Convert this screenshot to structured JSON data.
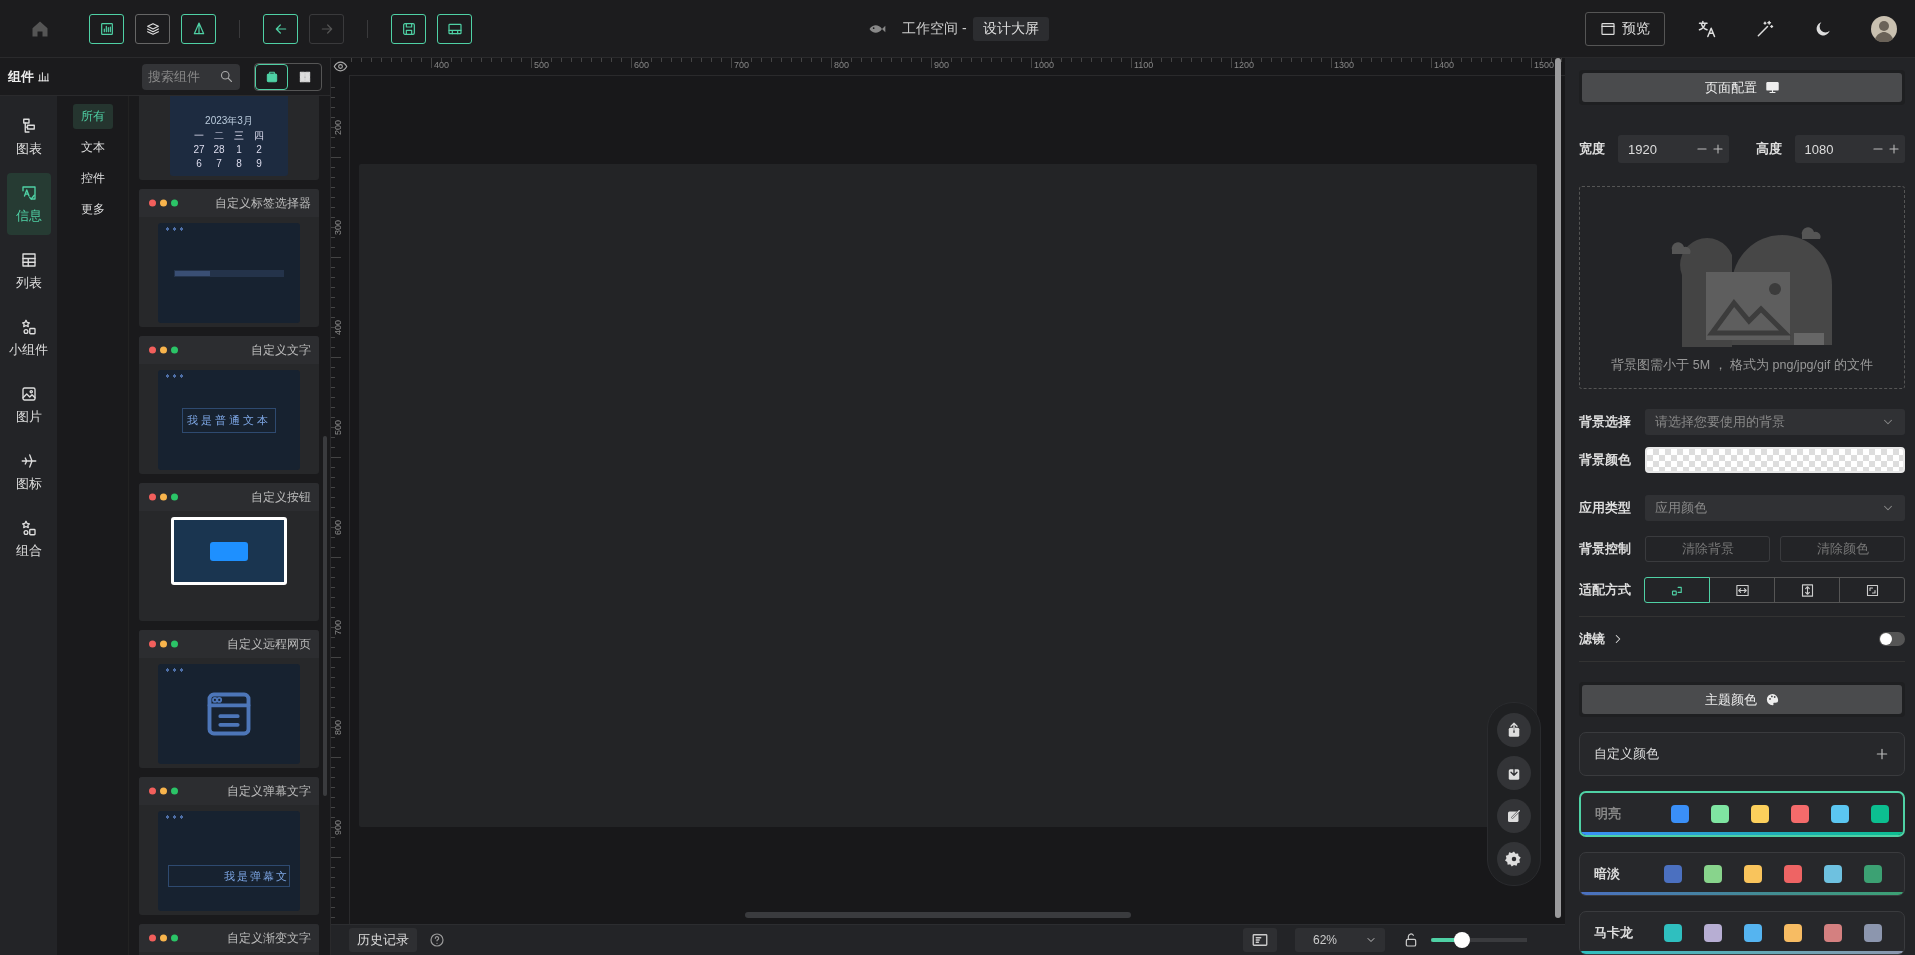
{
  "topbar": {
    "toggles": [
      {
        "kind": "chart",
        "on": true
      },
      {
        "kind": "layers",
        "on": false
      },
      {
        "kind": "cone",
        "on": true
      }
    ],
    "history": [
      {
        "kind": "undo",
        "disabled": false
      },
      {
        "kind": "redo",
        "disabled": true
      }
    ],
    "files": [
      {
        "kind": "save"
      },
      {
        "kind": "layout"
      }
    ],
    "workspace": "工作空间 -",
    "project": "设计大屏",
    "preview": "预览"
  },
  "components": {
    "title": "组件",
    "search": {
      "placeholder": "搜索组件"
    },
    "views": [
      {
        "kind": "card",
        "selected": true
      },
      {
        "kind": "grid",
        "selected": false
      }
    ],
    "groups": [
      {
        "label": "图表",
        "kind": "flow",
        "selected": false
      },
      {
        "label": "信息",
        "kind": "info",
        "selected": true
      },
      {
        "label": "列表",
        "kind": "table",
        "selected": false
      },
      {
        "label": "小组件",
        "kind": "widget",
        "selected": false
      },
      {
        "label": "图片",
        "kind": "image",
        "selected": false
      },
      {
        "label": "图标",
        "kind": "plane",
        "selected": false
      },
      {
        "label": "组合",
        "kind": "widget",
        "selected": false
      }
    ],
    "categories": [
      {
        "label": "所有",
        "selected": true
      },
      {
        "label": "文本",
        "selected": false
      },
      {
        "label": "控件",
        "selected": false
      },
      {
        "label": "更多",
        "selected": false
      }
    ],
    "cards": [
      {
        "kind": "calendar",
        "month": "2023年3月",
        "days": [
          "一",
          "二",
          "三",
          "四",
          "27",
          "28",
          "1",
          "2",
          "6",
          "7",
          "8",
          "9"
        ]
      },
      {
        "kind": "tags",
        "title": "自定义标签选择器"
      },
      {
        "kind": "text",
        "title": "自定义文字",
        "sample": "我是普通文本"
      },
      {
        "kind": "button",
        "title": "自定义按钮"
      },
      {
        "kind": "webpage",
        "title": "自定义远程网页"
      },
      {
        "kind": "danmaku",
        "title": "自定义弹幕文字",
        "sample": "我是弹幕文"
      },
      {
        "kind": "gradient",
        "title": "自定义渐变文字"
      }
    ]
  },
  "canvas": {
    "xticks": [
      "400",
      "500",
      "600",
      "700",
      "800",
      "900",
      "1000",
      "1100",
      "1200",
      "1300",
      "1400",
      "1500"
    ],
    "yticks": [
      "200",
      "300",
      "400",
      "500",
      "600",
      "700",
      "800",
      "900"
    ]
  },
  "bottom": {
    "history": "历史记录",
    "zoom": "62%",
    "scale": {
      "level": 0.32
    }
  },
  "config": {
    "page_header": "页面配置",
    "width": {
      "label": "宽度",
      "value": "1920"
    },
    "height": {
      "label": "高度",
      "value": "1080"
    },
    "upload_hint": "背景图需小于 5M ， 格式为 png/jpg/gif 的文件",
    "fields": [
      {
        "kind": "select",
        "label": "背景选择",
        "placeholder": "请选择您要使用的背景"
      },
      {
        "kind": "color",
        "label": "背景颜色"
      },
      {
        "kind": "select",
        "label": "应用类型",
        "placeholder": "应用颜色"
      },
      {
        "kind": "buttons",
        "label": "背景控制",
        "buttons": [
          "清除背景",
          "清除颜色"
        ]
      },
      {
        "kind": "modes",
        "label": "适配方式",
        "modes": [
          {
            "kind": "free",
            "selected": true
          },
          {
            "kind": "width",
            "selected": false
          },
          {
            "kind": "height",
            "selected": false
          },
          {
            "kind": "full",
            "selected": false
          }
        ]
      }
    ],
    "filter": {
      "label": "滤镜",
      "on": false
    },
    "theme_header": "主题颜色",
    "custom": "自定义颜色",
    "themes": [
      {
        "name": "明亮",
        "selected": true,
        "swatches": [
          {
            "color": "#3a8ff7"
          },
          {
            "color": "#7fe5a2"
          },
          {
            "color": "#fcd05c"
          },
          {
            "color": "#f46b6b"
          },
          {
            "color": "#5bc6f1"
          },
          {
            "color": "#0cbf90"
          }
        ]
      },
      {
        "name": "暗淡",
        "selected": false,
        "swatches": [
          {
            "color": "#4b70c0"
          },
          {
            "color": "#88d48c"
          },
          {
            "color": "#f9c45c"
          },
          {
            "color": "#ee6464"
          },
          {
            "color": "#6ec1e0"
          },
          {
            "color": "#3ca173"
          }
        ]
      },
      {
        "name": "马卡龙",
        "selected": false,
        "swatches": [
          {
            "color": "#2fbfbf"
          },
          {
            "color": "#b7aed3"
          },
          {
            "color": "#55b4f0"
          },
          {
            "color": "#f7bc63"
          },
          {
            "color": "#d48080"
          },
          {
            "color": "#8c96ae"
          }
        ]
      }
    ]
  }
}
